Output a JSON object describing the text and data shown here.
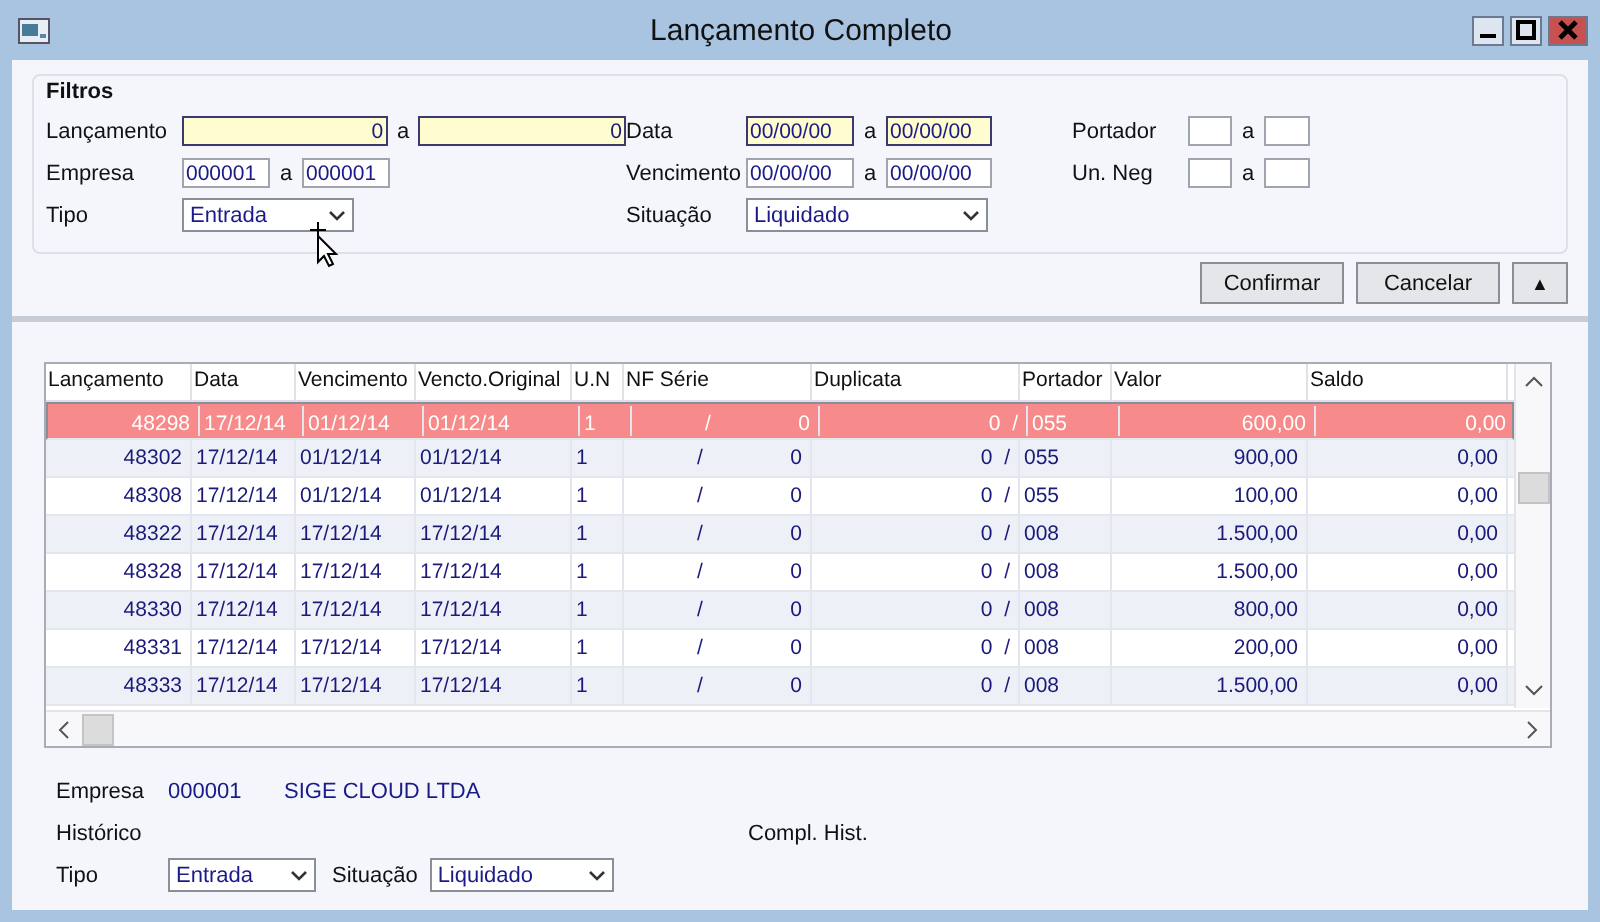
{
  "window": {
    "title": "Lançamento Completo"
  },
  "filters": {
    "title": "Filtros",
    "columns": [
      {
        "rows": [
          {
            "kind": "range",
            "label": "Lançamento",
            "sep": "a",
            "from": {
              "value": "0",
              "highlighted": true
            },
            "to": {
              "value": "0",
              "highlighted": true
            }
          },
          {
            "kind": "range",
            "label": "Empresa",
            "sep": "a",
            "from": {
              "value": "000001",
              "highlighted": false
            },
            "to": {
              "value": "000001",
              "highlighted": false
            }
          },
          {
            "kind": "select",
            "label": "Tipo",
            "value": "Entrada"
          }
        ]
      },
      {
        "rows": [
          {
            "kind": "range",
            "label": "Data",
            "sep": "a",
            "from": {
              "value": "00/00/00",
              "highlighted": true
            },
            "to": {
              "value": "00/00/00",
              "highlighted": true
            }
          },
          {
            "kind": "range",
            "label": "Vencimento",
            "sep": "a",
            "from": {
              "value": "00/00/00",
              "highlighted": false
            },
            "to": {
              "value": "00/00/00",
              "highlighted": false
            }
          },
          {
            "kind": "select",
            "label": "Situação",
            "value": "Liquidado"
          }
        ]
      },
      {
        "rows": [
          {
            "kind": "range",
            "label": "Portador",
            "sep": "a",
            "from": {
              "highlighted": false
            },
            "to": {
              "highlighted": false
            }
          },
          {
            "kind": "range",
            "label": "Un. Neg",
            "sep": "a",
            "from": {
              "highlighted": false
            },
            "to": {
              "highlighted": false
            }
          }
        ]
      }
    ]
  },
  "buttons": [
    {
      "label": "Confirmar",
      "kind": "text"
    },
    {
      "label": "Cancelar",
      "kind": "text"
    },
    {
      "label": "▲",
      "kind": "glyph"
    }
  ],
  "table": {
    "columns": [
      "Lançamento",
      "Data",
      "Vencimento",
      "Vencto.Original",
      "U.N",
      "NF Série",
      "Duplicata",
      "Portador",
      "Valor",
      "Saldo"
    ],
    "rows": [
      {
        "selected": true,
        "cells": [
          "48298",
          "17/12/14",
          "01/12/14",
          "01/12/14",
          "1",
          "/               0",
          "0  /",
          "055",
          "600,00",
          "0,00"
        ]
      },
      {
        "selected": false,
        "cells": [
          "48302",
          "17/12/14",
          "01/12/14",
          "01/12/14",
          "1",
          "/               0",
          "0  /",
          "055",
          "900,00",
          "0,00"
        ]
      },
      {
        "selected": false,
        "cells": [
          "48308",
          "17/12/14",
          "01/12/14",
          "01/12/14",
          "1",
          "/               0",
          "0  /",
          "055",
          "100,00",
          "0,00"
        ]
      },
      {
        "selected": false,
        "cells": [
          "48322",
          "17/12/14",
          "17/12/14",
          "17/12/14",
          "1",
          "/               0",
          "0  /",
          "008",
          "1.500,00",
          "0,00"
        ]
      },
      {
        "selected": false,
        "cells": [
          "48328",
          "17/12/14",
          "17/12/14",
          "17/12/14",
          "1",
          "/               0",
          "0  /",
          "008",
          "1.500,00",
          "0,00"
        ]
      },
      {
        "selected": false,
        "cells": [
          "48330",
          "17/12/14",
          "17/12/14",
          "17/12/14",
          "1",
          "/               0",
          "0  /",
          "008",
          "800,00",
          "0,00"
        ]
      },
      {
        "selected": false,
        "cells": [
          "48331",
          "17/12/14",
          "17/12/14",
          "17/12/14",
          "1",
          "/               0",
          "0  /",
          "008",
          "200,00",
          "0,00"
        ]
      },
      {
        "selected": false,
        "cells": [
          "48333",
          "17/12/14",
          "17/12/14",
          "17/12/14",
          "1",
          "/               0",
          "0  /",
          "008",
          "1.500,00",
          "0,00"
        ]
      }
    ]
  },
  "details": {
    "empresa": {
      "label": "Empresa",
      "code": "000001",
      "name": "SIGE CLOUD LTDA"
    },
    "historico": {
      "label": "Histórico"
    },
    "complemento": {
      "label": "Compl. Hist."
    },
    "tipo": {
      "label": "Tipo",
      "value": "Entrada"
    },
    "situacao": {
      "label": "Situação",
      "value": "Liquidado"
    }
  }
}
